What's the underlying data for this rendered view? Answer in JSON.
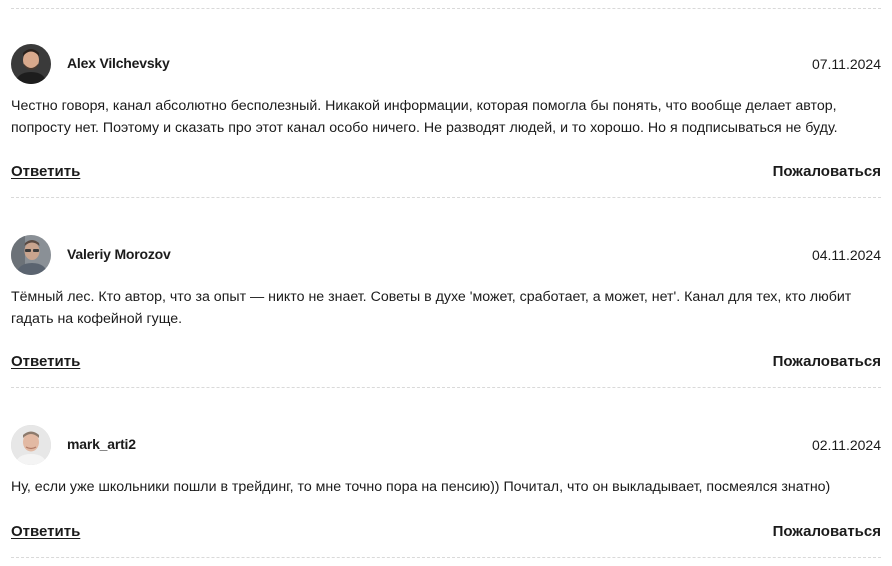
{
  "comments": [
    {
      "author": "Alex Vilchevsky",
      "date": "07.11.2024",
      "text": "Честно говоря, канал абсолютно бесполезный. Никакой информации, которая помогла бы понять, что вообще делает автор, попросту нет. Поэтому и сказать про этот канал особо ничего. Не разводят людей, и то хорошо. Но я подписываться не буду.",
      "reply_label": "Ответить",
      "report_label": "Пожаловаться"
    },
    {
      "author": "Valeriy Morozov",
      "date": "04.11.2024",
      "text": "Тёмный лес. Кто автор, что за опыт — никто не знает. Советы в духе 'может, сработает, а может, нет'. Канал для тех, кто любит гадать на кофейной гуще.",
      "reply_label": "Ответить",
      "report_label": "Пожаловаться"
    },
    {
      "author": "mark_arti2",
      "date": "02.11.2024",
      "text": "Ну, если уже школьники пошли в трейдинг, то мне точно пора на пенсию)) Почитал, что он выкладывает, посмеялся знатно)",
      "reply_label": "Ответить",
      "report_label": "Пожаловаться"
    }
  ]
}
